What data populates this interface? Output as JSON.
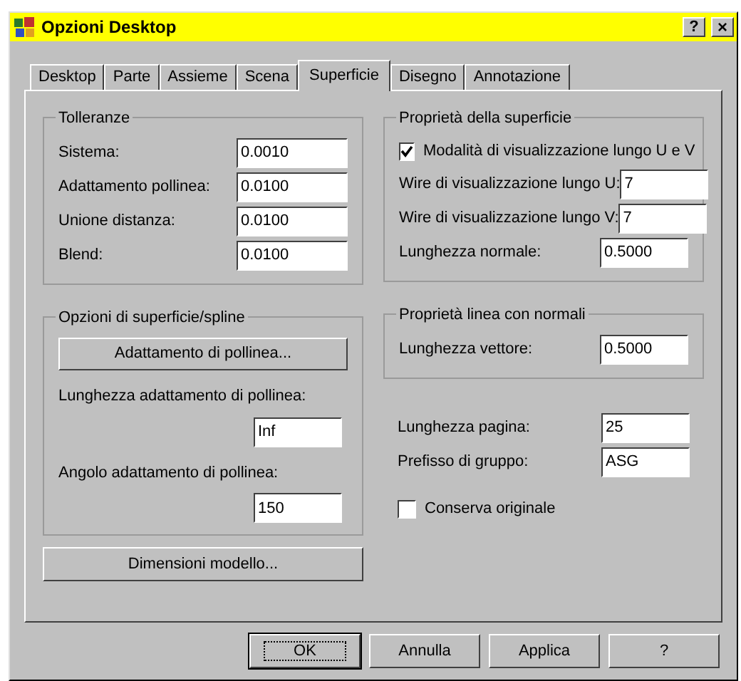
{
  "window": {
    "title": "Opzioni Desktop",
    "help": "?",
    "close": "×"
  },
  "tabs": [
    {
      "label": "Desktop",
      "selected": false
    },
    {
      "label": "Parte",
      "selected": false
    },
    {
      "label": "Assieme",
      "selected": false
    },
    {
      "label": "Scena",
      "selected": false
    },
    {
      "label": "Superficie",
      "selected": true
    },
    {
      "label": "Disegno",
      "selected": false
    },
    {
      "label": "Annotazione",
      "selected": false
    }
  ],
  "tolleranze": {
    "title": "Tolleranze",
    "fields": [
      {
        "label": "Sistema:",
        "value": "0.0010"
      },
      {
        "label": "Adattamento pollinea:",
        "value": "0.0100"
      },
      {
        "label": "Unione distanza:",
        "value": "0.0100"
      },
      {
        "label": "Blend:",
        "value": "0.0100"
      }
    ]
  },
  "opzioni_superficie": {
    "title": "Opzioni di superficie/spline",
    "button": "Adattamento di pollinea...",
    "fields": [
      {
        "label": "Lunghezza adattamento di pollinea:",
        "value": "Inf"
      },
      {
        "label": "Angolo adattamento di pollinea:",
        "value": "150"
      }
    ]
  },
  "dimensioni_button": "Dimensioni modello...",
  "proprieta_superficie": {
    "title": "Proprietà della superficie",
    "checkbox": {
      "label": "Modalità di visualizzazione lungo U e V",
      "checked": true
    },
    "fields": [
      {
        "label": "Wire di visualizzazione lungo U:",
        "value": "7"
      },
      {
        "label": "Wire di visualizzazione lungo V:",
        "value": "7"
      },
      {
        "label": "Lunghezza normale:",
        "value": "0.5000"
      }
    ]
  },
  "proprieta_linea": {
    "title": "Proprietà linea con normali",
    "fields": [
      {
        "label": "Lunghezza vettore:",
        "value": "0.5000"
      }
    ]
  },
  "extra_fields": [
    {
      "label": "Lunghezza pagina:",
      "value": "25"
    },
    {
      "label": "Prefisso di gruppo:",
      "value": "ASG"
    }
  ],
  "conserva": {
    "label": "Conserva originale",
    "checked": false
  },
  "buttons": [
    {
      "label": "OK",
      "default": true
    },
    {
      "label": "Annulla",
      "default": false
    },
    {
      "label": "Applica",
      "default": false
    },
    {
      "label": "?",
      "default": false
    }
  ]
}
